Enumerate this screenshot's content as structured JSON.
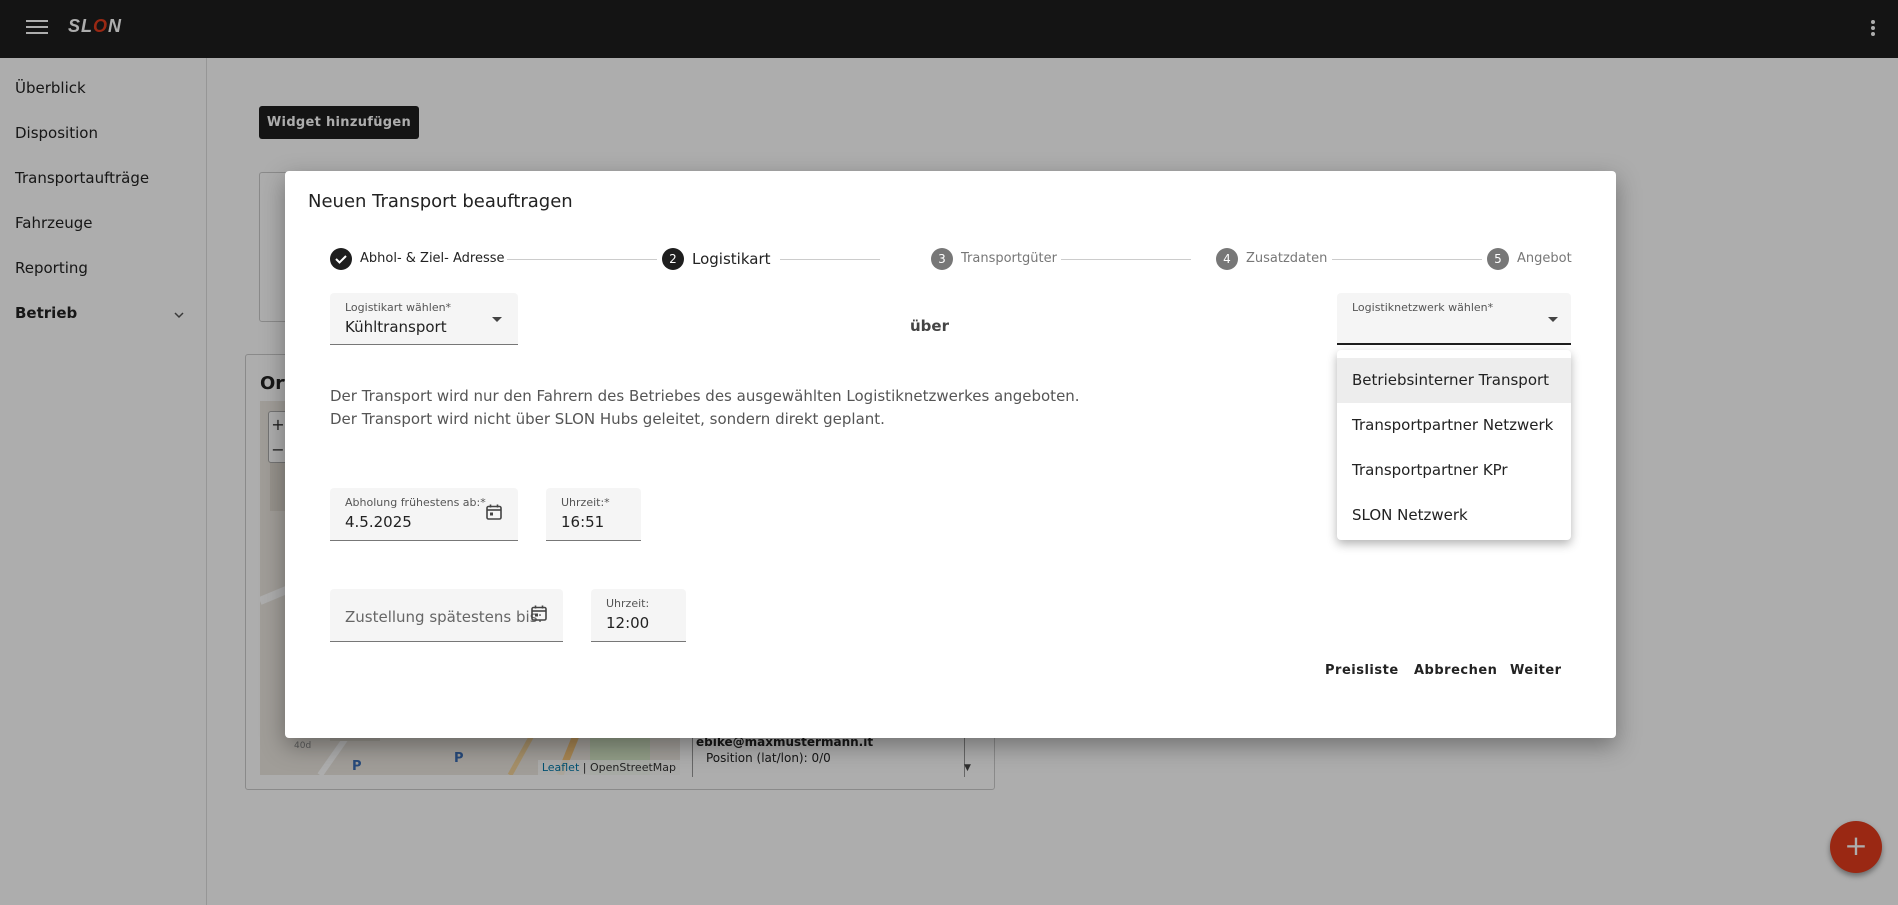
{
  "app": {
    "logo_text_s": "S",
    "logo_text_l": "L",
    "logo_text_o": "O",
    "logo_text_n": "N"
  },
  "sidebar": {
    "items": [
      {
        "label": "Überblick"
      },
      {
        "label": "Disposition"
      },
      {
        "label": "Transportaufträge"
      },
      {
        "label": "Fahrzeuge"
      },
      {
        "label": "Reporting"
      },
      {
        "label": "Betrieb"
      }
    ]
  },
  "dashboard": {
    "add_widget_label": "Widget hinzufügen",
    "card_title": "Ort",
    "map_attribution_leaflet": "Leaflet",
    "map_attribution_osm": "| OpenStreetMap",
    "info_email": "ebike@maxmustermann.it",
    "info_position": "Position (lat/lon): 0/0",
    "map_label_40d": "40d",
    "map_label_p": "P"
  },
  "dialog": {
    "title": "Neuen Transport beauftragen",
    "steps": [
      {
        "number": "✓",
        "label": "Abhol- & Ziel- Adresse",
        "state": "done"
      },
      {
        "number": "2",
        "label": "Logistikart",
        "state": "active"
      },
      {
        "number": "3",
        "label": "Transportgüter",
        "state": "todo"
      },
      {
        "number": "4",
        "label": "Zusatzdaten",
        "state": "todo"
      },
      {
        "number": "5",
        "label": "Angebot",
        "state": "todo"
      }
    ],
    "logistikart": {
      "label": "Logistikart wählen*",
      "value": "Kühltransport"
    },
    "ueber_label": "über",
    "netzwerk": {
      "label": "Logistiknetzwerk wählen*",
      "value": ""
    },
    "info_line1": "Der Transport wird nur den Fahrern des Betriebes des ausgewählten Logistiknetzwerkes angeboten.",
    "info_line2": "Der Transport wird nicht über SLON Hubs geleitet, sondern direkt geplant.",
    "abholung": {
      "label": "Abholung frühestens ab:*",
      "value": "4.5.2025"
    },
    "abholung_zeit": {
      "label": "Uhrzeit:*",
      "value": "16:51"
    },
    "zustellung": {
      "placeholder": "Zustellung spätestens bis:"
    },
    "zustellung_zeit": {
      "label": "Uhrzeit:",
      "value": "12:00"
    },
    "actions": {
      "preisliste": "Preisliste",
      "abbrechen": "Abbrechen",
      "weiter": "Weiter"
    }
  },
  "dropdown": {
    "options": [
      {
        "label": "Betriebsinterner Transport"
      },
      {
        "label": "Transportpartner Netzwerk"
      },
      {
        "label": "Transportpartner KPr"
      },
      {
        "label": "SLON Netzwerk"
      }
    ]
  },
  "fab": {
    "label": "+"
  },
  "colors": {
    "accent": "#e43c1c",
    "appbar": "#1e1e1e"
  }
}
